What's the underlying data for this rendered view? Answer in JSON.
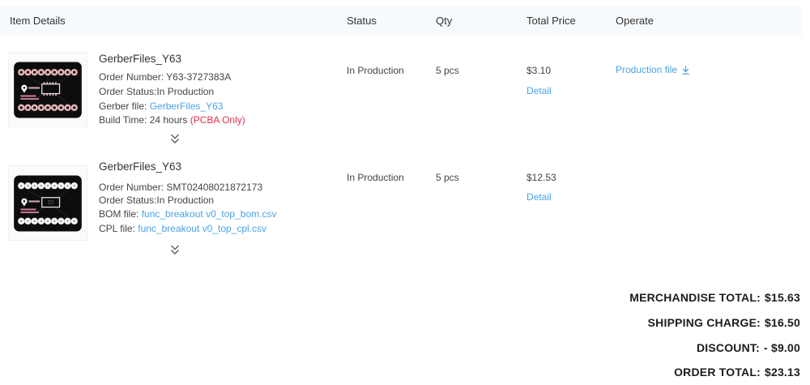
{
  "header": {
    "columns": [
      "Item Details",
      "Status",
      "Qty",
      "Total Price",
      "Operate"
    ]
  },
  "rows": [
    {
      "title": "GerberFiles_Y63",
      "order_number_label": "Order Number: ",
      "order_number": "Y63-3727383A",
      "order_status_label": "Order Status:",
      "order_status": "In Production",
      "file1_label": "Gerber file: ",
      "file1": "GerberFiles_Y63",
      "build_time_label": "Build Time: ",
      "build_time": "24 hours ",
      "build_time_note": "(PCBA Only)",
      "status": "In Production",
      "qty": "5 pcs",
      "total_price": "$3.10",
      "detail_label": "Detail",
      "operate_label": "Production file"
    },
    {
      "title": "GerberFiles_Y63",
      "order_number_label": "Order Number: ",
      "order_number": "SMT02408021872173",
      "order_status_label": "Order Status:",
      "order_status": "In Production",
      "file1_label": "BOM file: ",
      "file1": "func_breakout v0_top_bom.csv",
      "file2_label": "CPL file: ",
      "file2": "func_breakout v0_top_cpl.csv",
      "status": "In Production",
      "qty": "5 pcs",
      "total_price": "$12.53",
      "detail_label": "Detail"
    }
  ],
  "summary": [
    {
      "label": "MERCHANDISE TOTAL:",
      "value": "$15.63"
    },
    {
      "label": "SHIPPING CHARGE:",
      "value": "$16.50"
    },
    {
      "label": "DISCOUNT:",
      "value": "- $9.00"
    },
    {
      "label": "ORDER TOTAL:",
      "value": "$23.13"
    }
  ],
  "colors": {
    "link": "#4aa3e8",
    "alert": "#e0304e",
    "header_bg": "#f7fafd",
    "pcb_body": "#0d0d0d",
    "pad_pink": "#eab6ba",
    "pad_white": "#f4f4f4"
  },
  "icons": {
    "expander": "double-chevron-down",
    "download": "arrow-down-to-line"
  }
}
